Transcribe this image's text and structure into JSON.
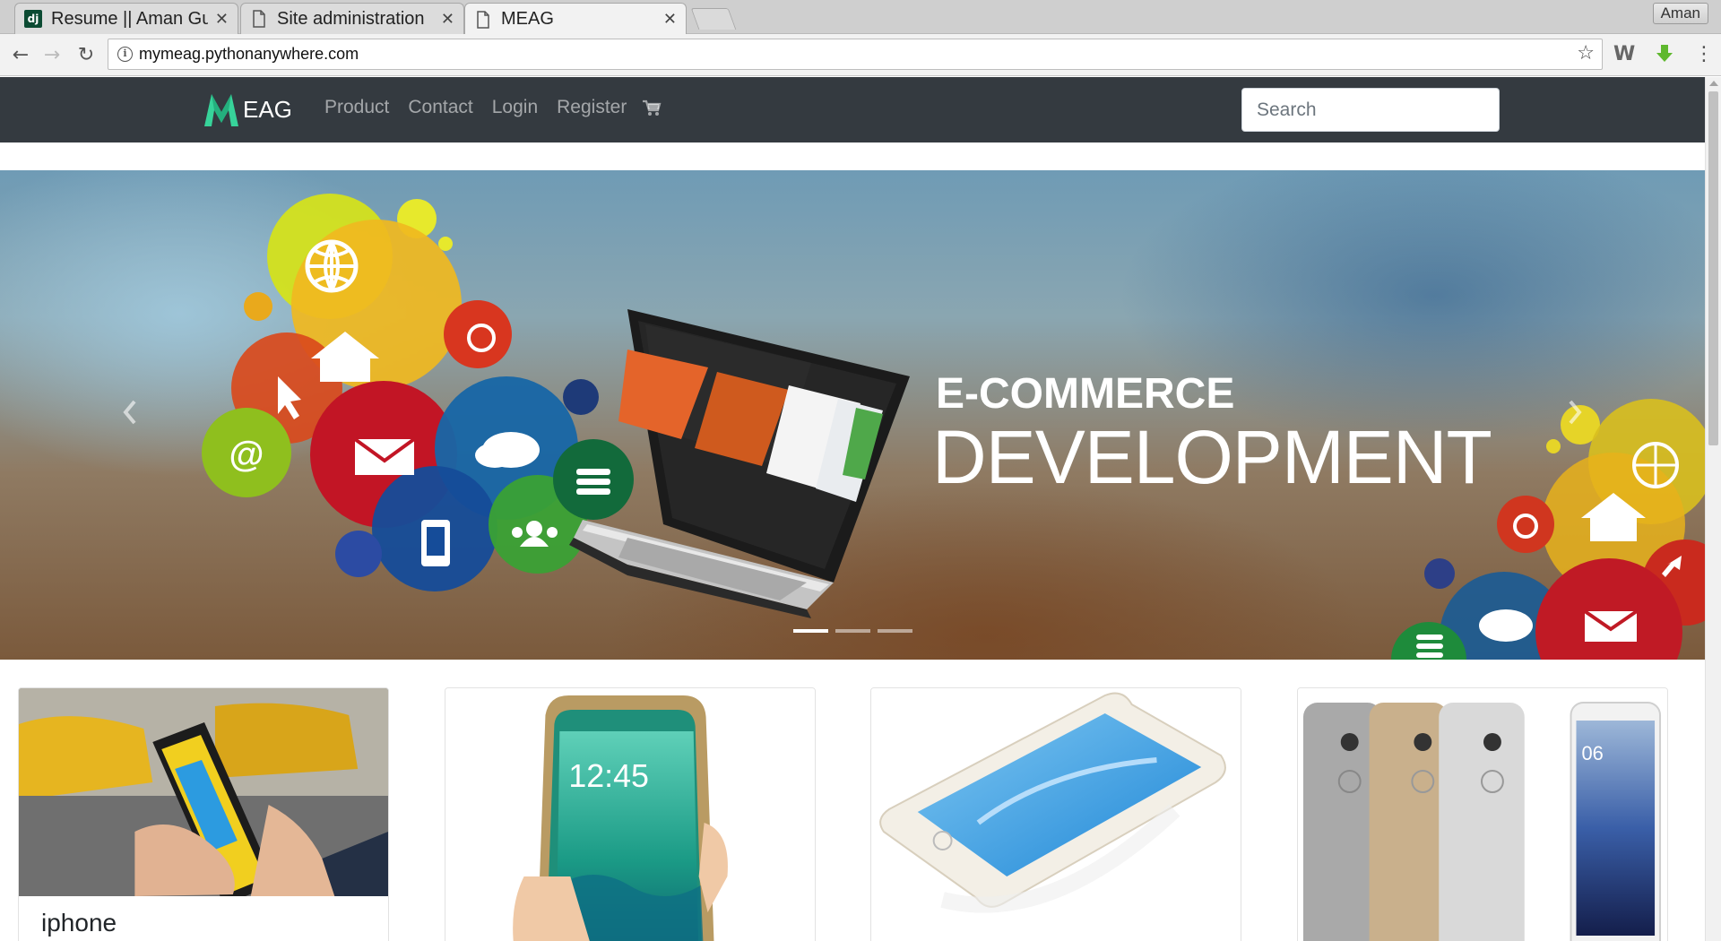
{
  "browser": {
    "tabs": [
      {
        "title": "Resume || Aman Gu",
        "favicon": "django-icon",
        "active": false
      },
      {
        "title": "Site administration",
        "favicon": "page-icon",
        "active": false
      },
      {
        "title": "MEAG",
        "favicon": "page-icon",
        "active": true
      }
    ],
    "profile_name": "Aman",
    "url": "mymeag.pythonanywhere.com"
  },
  "site": {
    "brand": "EAG",
    "nav_links": [
      "Product",
      "Contact",
      "Login",
      "Register"
    ],
    "cart_icon": "shopping-cart-icon",
    "search_placeholder": "Search"
  },
  "carousel": {
    "heading_line1": "E-COMMERCE",
    "heading_line2": "DEVELOPMENT",
    "slide_count": 3,
    "active_slide": 1
  },
  "products": [
    {
      "name": "iphone"
    },
    {
      "name": ""
    },
    {
      "name": ""
    },
    {
      "name": ""
    }
  ],
  "colors": {
    "navbar": "#343a40",
    "brand_logo": "#37d39a"
  }
}
